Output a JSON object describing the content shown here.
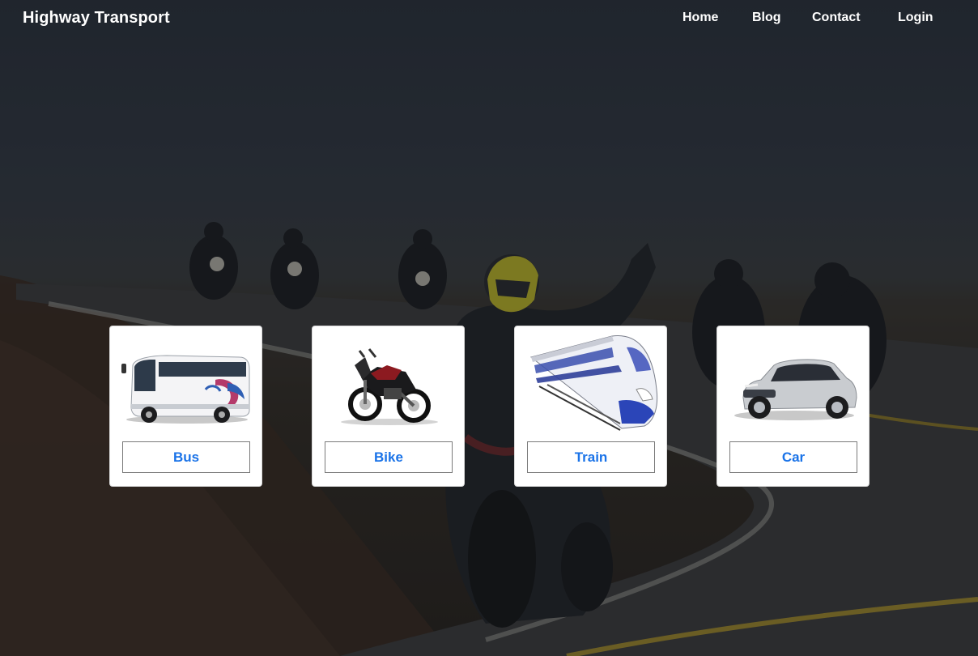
{
  "header": {
    "brand": "Highway Transport",
    "nav": {
      "home": "Home",
      "blog": "Blog",
      "contact": "Contact",
      "login": "Login"
    }
  },
  "background": {
    "description_icon": "motorcycle-riders-photo"
  },
  "cards": [
    {
      "label": "Bus",
      "image_icon": "bus-image"
    },
    {
      "label": "Bike",
      "image_icon": "motorbike-image"
    },
    {
      "label": "Train",
      "image_icon": "bullet-train-image"
    },
    {
      "label": "Car",
      "image_icon": "car-image"
    }
  ],
  "colors": {
    "button_text": "#1a73e8",
    "nav_text": "#ffffff",
    "card_bg": "#ffffff"
  }
}
